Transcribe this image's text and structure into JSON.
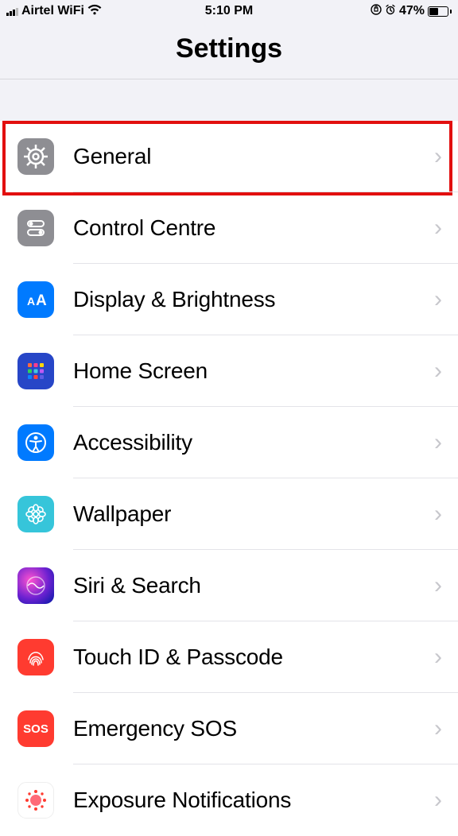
{
  "status": {
    "carrier": "Airtel WiFi",
    "time": "5:10 PM",
    "battery_percent": "47%"
  },
  "header": {
    "title": "Settings"
  },
  "rows": {
    "general": "General",
    "control": "Control Centre",
    "display": "Display & Brightness",
    "home": "Home Screen",
    "access": "Accessibility",
    "wallpaper": "Wallpaper",
    "siri": "Siri & Search",
    "touch": "Touch ID & Passcode",
    "sos": "Emergency SOS",
    "sos_icon_text": "SOS",
    "exposure": "Exposure Notifications"
  }
}
